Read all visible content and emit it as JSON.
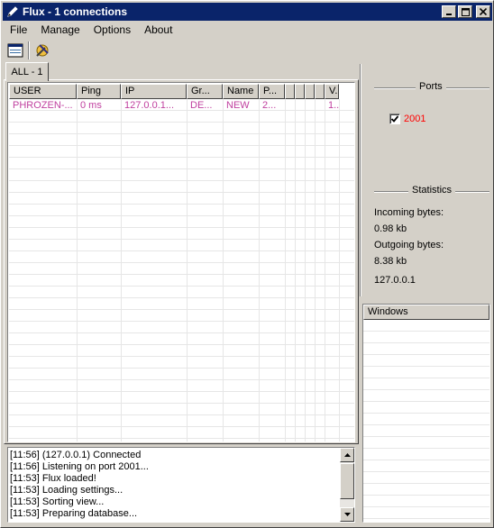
{
  "window": {
    "title": "Flux - 1 connections",
    "minimize_label": "_",
    "maximize_label": "□",
    "close_label": "✕"
  },
  "menu": [
    "File",
    "Manage",
    "Options",
    "About"
  ],
  "toolbar": {
    "icons": [
      "window-list-icon",
      "settings-tools-icon"
    ]
  },
  "tab": {
    "label": "ALL - 1"
  },
  "listview": {
    "columns": [
      "USER",
      "Ping",
      "IP",
      "Gr...",
      "Name",
      "P...",
      "",
      "",
      "",
      "",
      "V."
    ],
    "rows": [
      {
        "cells": [
          "PHROZEN-...",
          "0 ms",
          "127.0.0.1...",
          "DE...",
          "NEW",
          "2...",
          "",
          "",
          "",
          "",
          "1..."
        ]
      }
    ],
    "row_color": "#c0409f"
  },
  "ports": {
    "title": "Ports",
    "items": [
      {
        "value": "2001",
        "checked": true,
        "color": "#ff0000"
      }
    ]
  },
  "statistics": {
    "title": "Statistics",
    "incoming_label": "Incoming bytes:",
    "incoming_value": "0.98 kb",
    "outgoing_label": "Outgoing bytes:",
    "outgoing_value": "8.38 kb",
    "ip": "127.0.0.1"
  },
  "windows_panel": {
    "header": "Windows"
  },
  "log": [
    "[11:56] (127.0.0.1) Connected",
    "[11:56] Listening on port 2001...",
    "[11:53] Flux loaded!",
    "[11:53] Loading settings...",
    "[11:53] Sorting view...",
    "[11:53] Preparing database..."
  ],
  "colors": {
    "titlebar": "#0a246a",
    "face": "#d4d0c8"
  }
}
